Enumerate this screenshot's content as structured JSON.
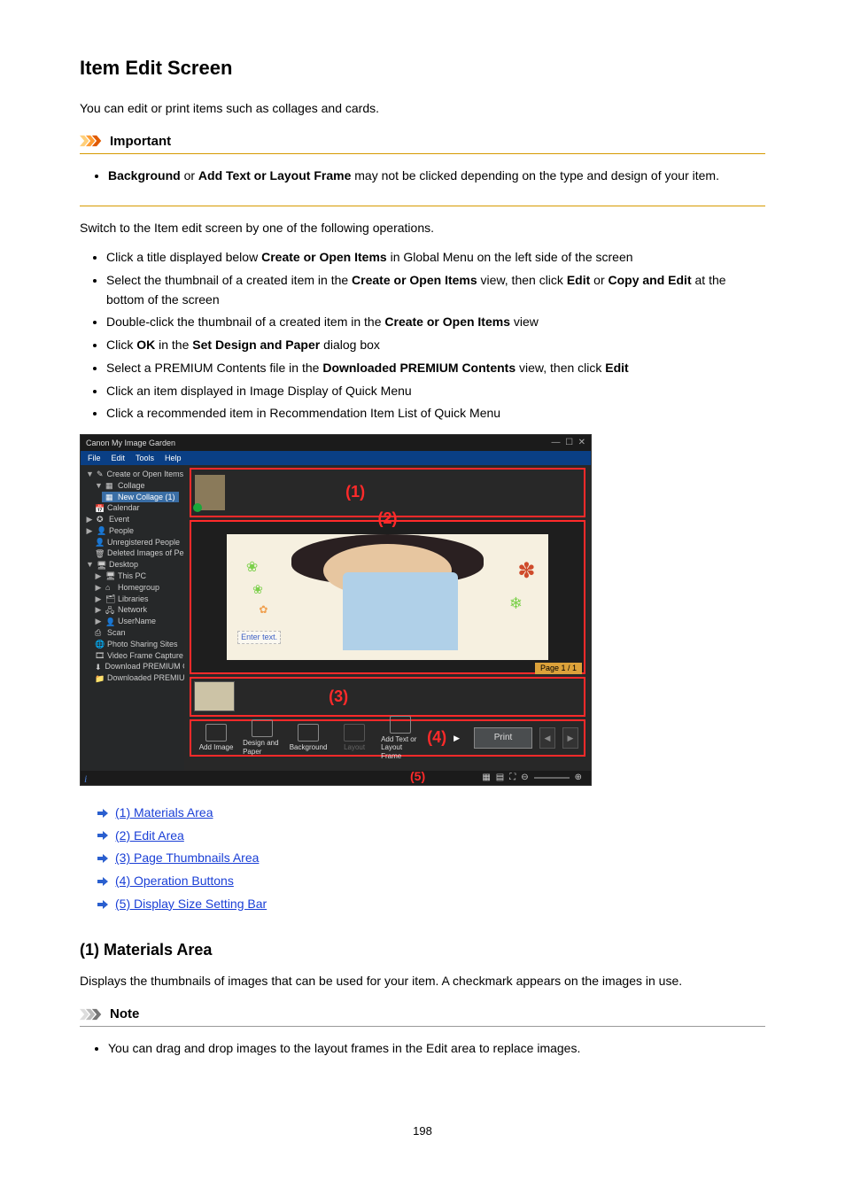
{
  "page": {
    "number": "198"
  },
  "heading": "Item Edit Screen",
  "intro": "You can edit or print items such as collages and cards.",
  "important": {
    "title": "Important",
    "bullets": [
      {
        "pre": "",
        "b1": "Background",
        "mid": " or ",
        "b2": "Add Text or Layout Frame",
        "post": " may not be clicked depending on the type and design of your item."
      }
    ]
  },
  "switch_text": "Switch to the Item edit screen by one of the following operations.",
  "ops": [
    {
      "pre": "Click a title displayed below ",
      "b1": "Create or Open Items",
      "mid": " in Global Menu on the left side of the screen",
      "b2": "",
      "post": ""
    },
    {
      "pre": "Select the thumbnail of a created item in the ",
      "b1": "Create or Open Items",
      "mid": " view, then click ",
      "b2": "Edit",
      "mid2": " or ",
      "b3": "Copy and Edit",
      "post": " at the bottom of the screen"
    },
    {
      "pre": "Double-click the thumbnail of a created item in the ",
      "b1": "Create or Open Items",
      "mid": " view",
      "b2": "",
      "post": ""
    },
    {
      "pre": "Click ",
      "b1": "OK",
      "mid": " in the ",
      "b2": "Set Design and Paper",
      "post": " dialog box"
    },
    {
      "pre": "Select a PREMIUM Contents file in the ",
      "b1": "Downloaded PREMIUM Contents",
      "mid": " view, then click ",
      "b2": "Edit",
      "post": ""
    },
    {
      "pre": "Click an item displayed in Image Display of Quick Menu",
      "b1": "",
      "mid": "",
      "b2": "",
      "post": ""
    },
    {
      "pre": "Click a recommended item in Recommendation Item List of Quick Menu",
      "b1": "",
      "mid": "",
      "b2": "",
      "post": ""
    }
  ],
  "shot": {
    "title": "Canon My Image Garden",
    "menus": [
      "File",
      "Edit",
      "Tools",
      "Help"
    ],
    "sidebar": {
      "create": "Create or Open Items",
      "collage": "Collage",
      "new_collage": "New Collage (1)",
      "calendar": "Calendar",
      "event": "Event",
      "people": "People",
      "unreg": "Unregistered People",
      "deleted": "Deleted Images of People",
      "desktop": "Desktop",
      "thispc": "This PC",
      "homegroup": "Homegroup",
      "libraries": "Libraries",
      "network": "Network",
      "username": "UserName",
      "scan": "Scan",
      "sites": "Photo Sharing Sites",
      "video": "Video Frame Capture",
      "dlp": "Download PREMIUM Contents",
      "dlpd": "Downloaded PREMIUM Contents"
    },
    "markers": {
      "m1": "(1)",
      "m2": "(2)",
      "m3": "(3)",
      "m4": "(4)",
      "m5": "(5)"
    },
    "canvas": {
      "text": "Enter text.",
      "page": "Page 1 / 1"
    },
    "buttons": {
      "add_image": "Add Image",
      "design": "Design and Paper",
      "background": "Background",
      "layout": "Layout",
      "add_text": "Add Text or Layout Frame",
      "print": "Print"
    }
  },
  "links": [
    "(1) Materials Area",
    "(2) Edit Area",
    "(3) Page Thumbnails Area",
    "(4) Operation Buttons",
    "(5) Display Size Setting Bar"
  ],
  "section1": {
    "title": "(1) Materials Area",
    "body": "Displays the thumbnails of images that can be used for your item. A checkmark appears on the images in use."
  },
  "note": {
    "title": "Note",
    "bullet": "You can drag and drop images to the layout frames in the Edit area to replace images."
  }
}
